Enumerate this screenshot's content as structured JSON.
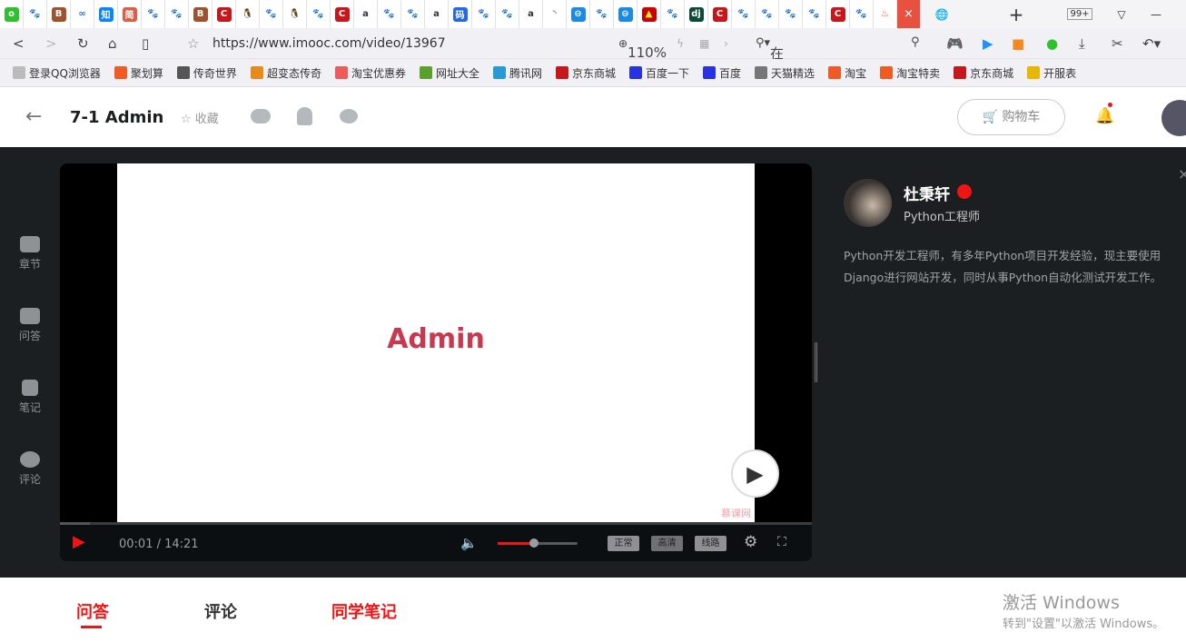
{
  "browser": {
    "tab_icons": [
      "o",
      "paw",
      "B",
      "oo",
      "知",
      "简",
      "paw",
      "paw",
      "B",
      "C",
      "peng",
      "paw",
      "peng",
      "paw",
      "C",
      "a",
      "paw",
      "paw",
      "a",
      "码",
      "paw",
      "paw",
      "a",
      "◝",
      "te",
      "paw",
      "te",
      "art",
      "paw",
      "dj",
      "C",
      "paw",
      "paw",
      "paw",
      "paw",
      "C",
      "paw",
      "fire"
    ],
    "active_tab_close": "×",
    "tab_count_badge": "99+",
    "url": "https://www.imooc.com/video/13967",
    "zoom": "110%",
    "search_placeholder": "在此搜索",
    "bookmarks": [
      {
        "label": "登录QQ浏览器",
        "color": "#bbb"
      },
      {
        "label": "聚划算",
        "color": "#f05a24"
      },
      {
        "label": "传奇世界",
        "color": "#555"
      },
      {
        "label": "超变态传奇",
        "color": "#e88a1a"
      },
      {
        "label": "淘宝优惠券",
        "color": "#ef5b5b"
      },
      {
        "label": "网址大全",
        "color": "#5aa02c"
      },
      {
        "label": "腾讯网",
        "color": "#2a9ad6"
      },
      {
        "label": "京东商城",
        "color": "#c8161d"
      },
      {
        "label": "百度一下",
        "color": "#2932e1"
      },
      {
        "label": "百度",
        "color": "#2932e1"
      },
      {
        "label": "天猫精选",
        "color": "#777"
      },
      {
        "label": "淘宝",
        "color": "#f05a24"
      },
      {
        "label": "淘宝特卖",
        "color": "#f05a24"
      },
      {
        "label": "京东商城",
        "color": "#c8161d"
      },
      {
        "label": "开服表",
        "color": "#e8b800"
      }
    ]
  },
  "header": {
    "title": "7-1 Admin",
    "favorite": "收藏",
    "cart": "购物车"
  },
  "sidebar": [
    {
      "label": "章节"
    },
    {
      "label": "问答"
    },
    {
      "label": "笔记"
    },
    {
      "label": "评论"
    }
  ],
  "video": {
    "slide_title": "Admin",
    "watermark": "慕课网",
    "time": "00:01 / 14:21",
    "progress": 0.0012,
    "volume": 0.46,
    "quality": [
      "正常",
      "高清",
      "线路"
    ]
  },
  "teacher": {
    "name": "杜秉轩",
    "role": "Python工程师",
    "bio_line1": "Python开发工程师，有多年Python项目开发经验，现主要使用",
    "bio_line2": "Django进行网站开发，同时从事Python自动化测试开发工作。"
  },
  "bottom_tabs": [
    "问答",
    "评论",
    "同学笔记"
  ],
  "windows": {
    "line1": "激活 Windows",
    "line2": "转到\"设置\"以激活 Windows。"
  },
  "colors": {
    "accent": "#f01414",
    "dark_bg": "#1c1f21",
    "slide_title": "#c8384f"
  }
}
